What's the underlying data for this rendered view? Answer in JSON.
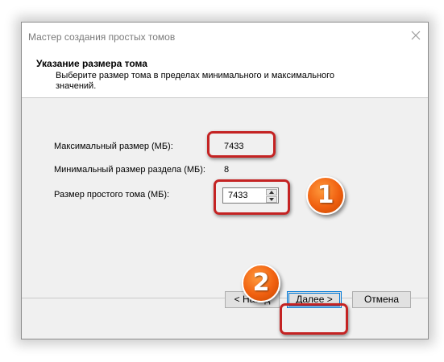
{
  "window": {
    "title": "Мастер создания простых томов"
  },
  "header": {
    "title": "Указание размера тома",
    "description": "Выберите размер тома в пределах минимального и максимального значений."
  },
  "fields": {
    "max_label": "Максимальный размер (МБ):",
    "max_value": "7433",
    "min_label": "Минимальный размер раздела (МБ):",
    "min_value": "8",
    "size_label": "Размер простого тома (МБ):",
    "size_value": "7433"
  },
  "buttons": {
    "back": "< Назад",
    "next": "Далее >",
    "cancel": "Отмена"
  },
  "annotations": {
    "marker_1": "1",
    "marker_2": "2"
  },
  "colors": {
    "highlight": "#c42323",
    "badge": "#f06010",
    "accent": "#0078d7"
  }
}
